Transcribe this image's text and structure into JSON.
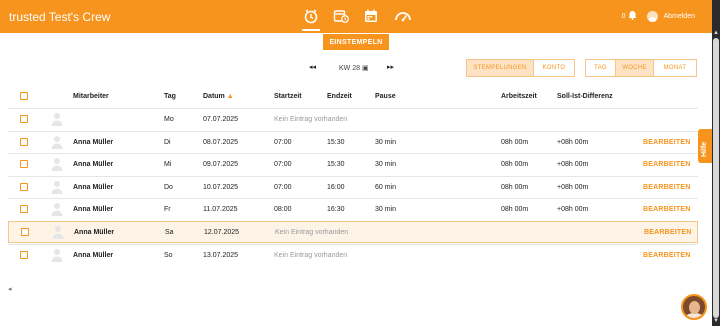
{
  "header": {
    "brand": "trusted Test's Crew",
    "notification_count": "0",
    "logout_label": "Abmelden",
    "nav_icons": [
      "clock-icon",
      "calendar-clock-icon",
      "calendar-icon",
      "tachometer-icon"
    ],
    "accent_color": "#f7941d"
  },
  "stempeln": {
    "label": "EINSTEMPELN"
  },
  "week_nav": {
    "label": "KW 28",
    "calendar_glyph": "▣"
  },
  "view_tabs_left": {
    "stempelungen": "STEMPELUNGEN",
    "konto": "KONTO"
  },
  "view_tabs_right": {
    "tag": "TAG",
    "woche": "WOCHE",
    "monat": "MONAT"
  },
  "table": {
    "headers": {
      "mitarbeiter": "Mitarbeiter",
      "tag": "Tag",
      "datum": "Datum",
      "startzeit": "Startzeit",
      "endzeit": "Endzeit",
      "pause": "Pause",
      "arbeitszeit": "Arbeitszeit",
      "differenz": "Soll-Ist-Differenz"
    },
    "empty_text": "Kein Eintrag vorhanden",
    "edit_label": "BEARBEITEN",
    "rows": [
      {
        "name": "",
        "day": "Mo",
        "date": "07.07.2025",
        "start": "",
        "end": "",
        "pause": "",
        "work": "",
        "diff": "",
        "empty": true,
        "editable": false
      },
      {
        "name": "Anna Müller",
        "day": "Di",
        "date": "08.07.2025",
        "start": "07:00",
        "end": "15:30",
        "pause": "30 min",
        "work": "08h 00m",
        "diff": "+08h 00m",
        "empty": false,
        "editable": true
      },
      {
        "name": "Anna Müller",
        "day": "Mi",
        "date": "09.07.2025",
        "start": "07:00",
        "end": "15:30",
        "pause": "30 min",
        "work": "08h 00m",
        "diff": "+08h 00m",
        "empty": false,
        "editable": true
      },
      {
        "name": "Anna Müller",
        "day": "Do",
        "date": "10.07.2025",
        "start": "07:00",
        "end": "16:00",
        "pause": "60 min",
        "work": "08h 00m",
        "diff": "+08h 00m",
        "empty": false,
        "editable": true
      },
      {
        "name": "Anna Müller",
        "day": "Fr",
        "date": "11.07.2025",
        "start": "08:00",
        "end": "16:30",
        "pause": "30 min",
        "work": "08h 00m",
        "diff": "+08h 00m",
        "empty": false,
        "editable": true
      },
      {
        "name": "Anna Müller",
        "day": "Sa",
        "date": "12.07.2025",
        "start": "",
        "end": "",
        "pause": "",
        "work": "",
        "diff": "",
        "empty": true,
        "editable": true,
        "highlight": true
      },
      {
        "name": "Anna Müller",
        "day": "So",
        "date": "13.07.2025",
        "start": "",
        "end": "",
        "pause": "",
        "work": "",
        "diff": "",
        "empty": true,
        "editable": true
      }
    ]
  },
  "hilfe": {
    "label": "Hilfe"
  }
}
